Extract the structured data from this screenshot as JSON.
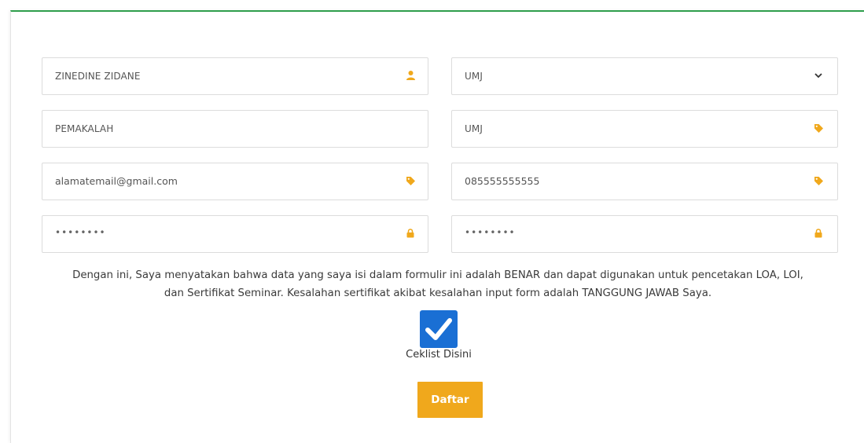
{
  "form": {
    "name_field": {
      "value": "ZINEDINE ZIDANE",
      "icon": "user-icon"
    },
    "institution_select": {
      "value": "UMJ",
      "icon": "chevron-down-icon"
    },
    "role_field": {
      "value": "PEMAKALAH"
    },
    "institution_field": {
      "value": "UMJ",
      "icon": "tag-icon"
    },
    "email_field": {
      "value": "alamatemail@gmail.com",
      "icon": "tag-icon"
    },
    "phone_field": {
      "value": "085555555555",
      "icon": "tag-icon"
    },
    "password_field": {
      "value": "••••••••",
      "icon": "lock-icon"
    },
    "confirm_password_field": {
      "value": "••••••••",
      "icon": "lock-icon"
    }
  },
  "statement": {
    "line1": "Dengan ini, Saya menyatakan bahwa data yang saya isi dalam formulir ini adalah BENAR dan dapat digunakan untuk pencetakan LOA, LOI,",
    "line2": "dan Sertifikat Seminar. Kesalahan sertifikat akibat kesalahan input form adalah TANGGUNG JAWAB Saya."
  },
  "agreement": {
    "label": "Ceklist Disini",
    "checked": true
  },
  "submit_label": "Daftar",
  "colors": {
    "accent_orange": "#f0a81c",
    "checkbox_blue": "#1a6fd4",
    "top_border_green": "#2e9e4c"
  }
}
